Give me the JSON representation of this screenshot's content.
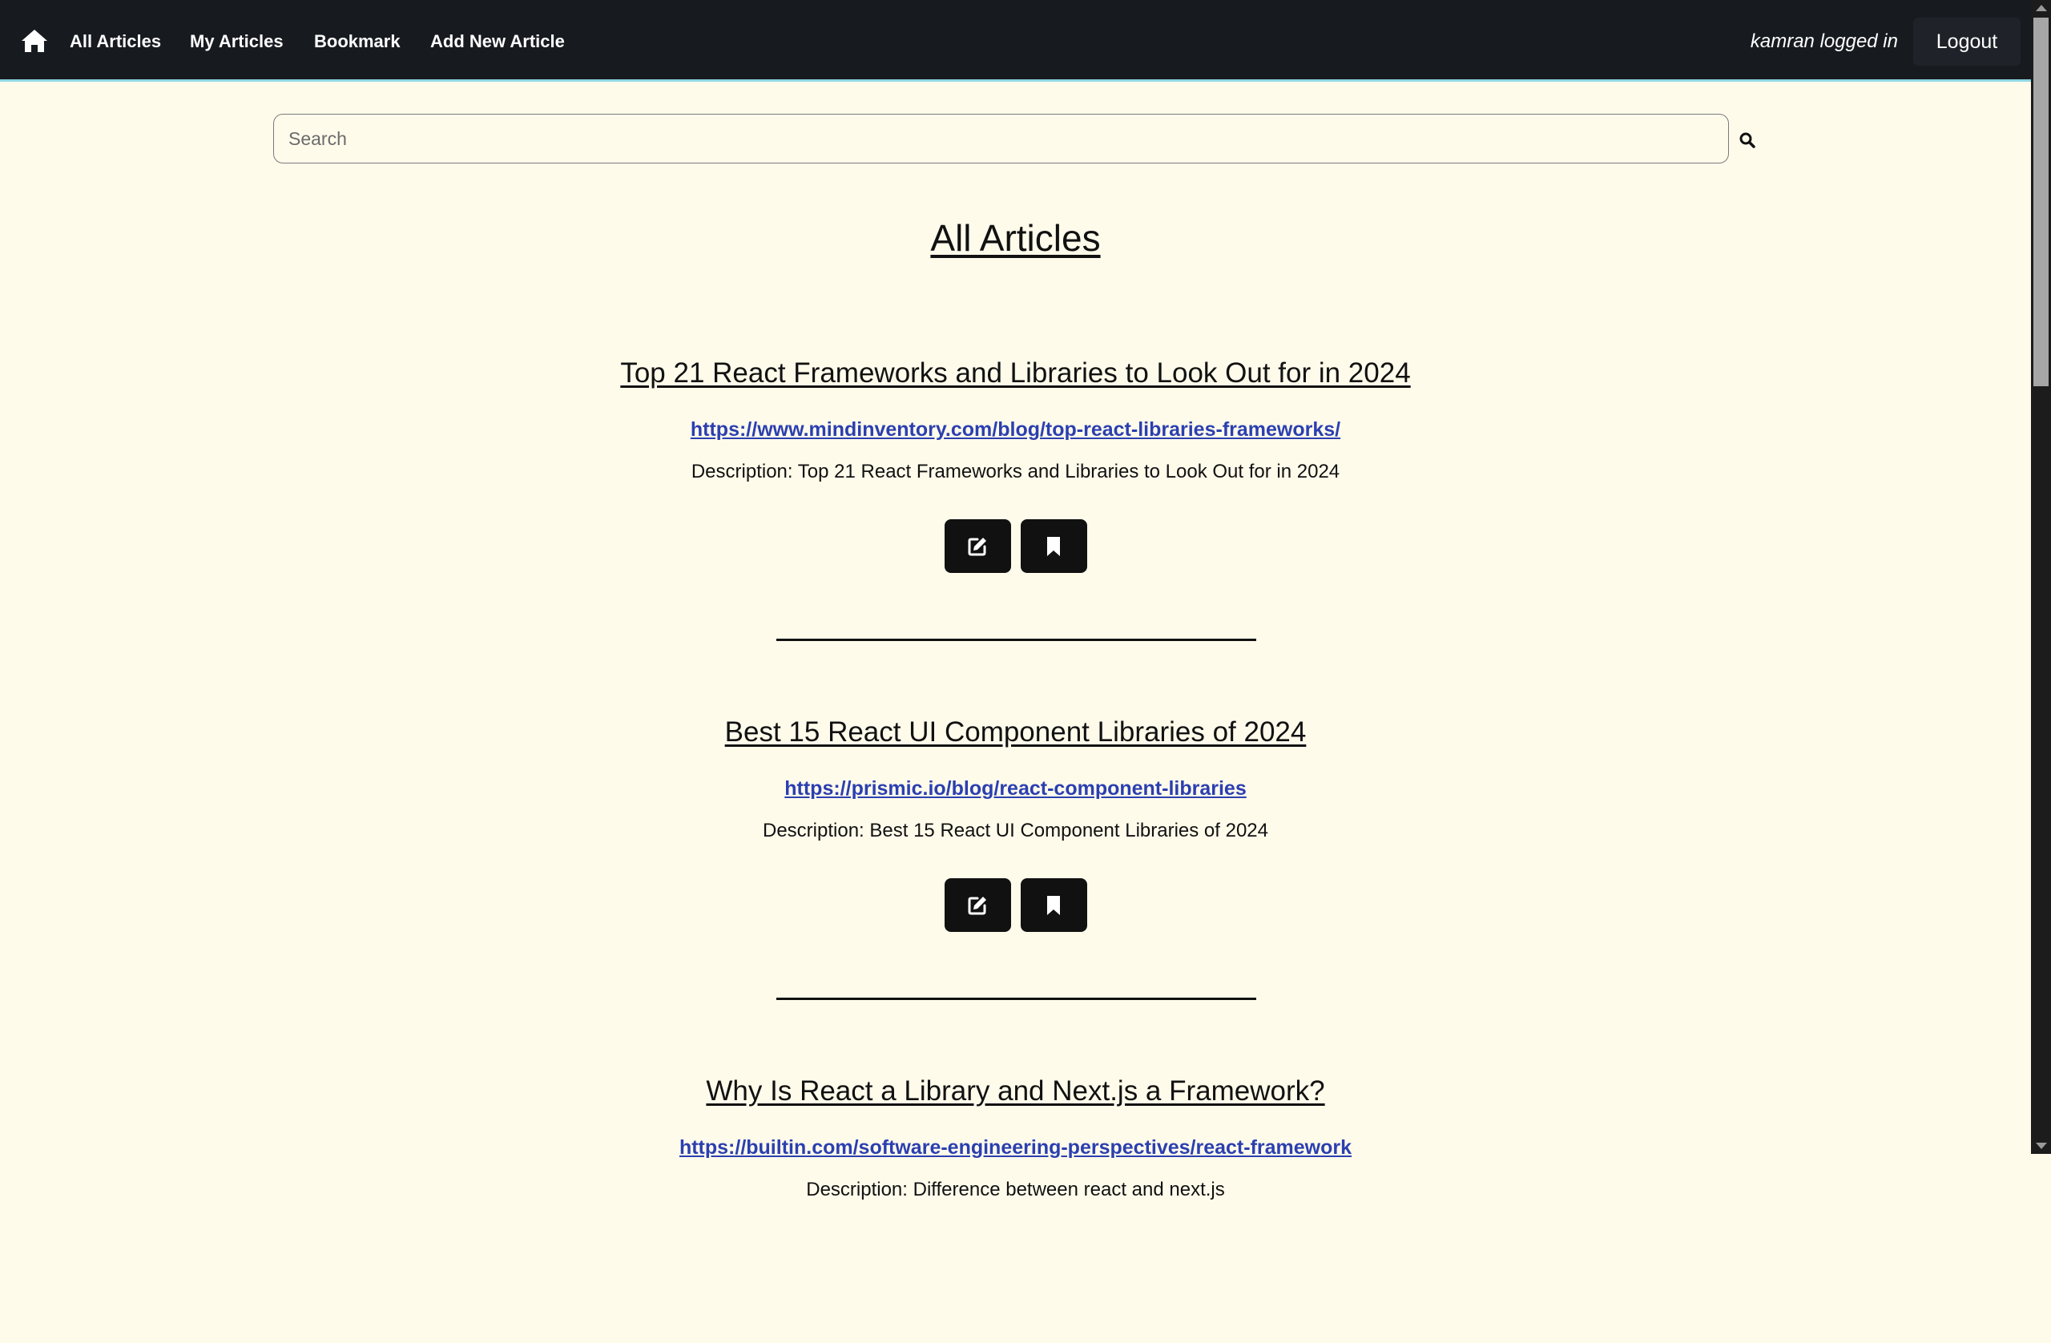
{
  "navbar": {
    "home_icon": "home-icon",
    "links": [
      "All Articles",
      "My Articles",
      "Bookmark",
      "Add New Article"
    ],
    "user_status": "kamran logged in",
    "logout_label": "Logout"
  },
  "search": {
    "placeholder": "Search",
    "value": "",
    "icon": "search-icon"
  },
  "main": {
    "title": "All Articles",
    "articles": [
      {
        "title": "Top 21 React Frameworks and Libraries to Look Out for in 2024",
        "url": "https://www.mindinventory.com/blog/top-react-libraries-frameworks/",
        "description": "Description: Top 21 React Frameworks and Libraries to Look Out for in 2024"
      },
      {
        "title": "Best 15 React UI Component Libraries of 2024",
        "url": "https://prismic.io/blog/react-component-libraries",
        "description": "Description: Best 15 React UI Component Libraries of 2024"
      },
      {
        "title": "Why Is React a Library and Next.js a Framework?",
        "url": "https://builtin.com/software-engineering-perspectives/react-framework",
        "description": "Description: Difference between react and next.js"
      }
    ],
    "action_icons": [
      "edit-icon",
      "bookmark-icon"
    ]
  },
  "colors": {
    "navbar_bg": "#171a1f",
    "page_bg": "#fffbeb",
    "link": "#2b3fb0",
    "accent_line": "#8fd8e6"
  }
}
